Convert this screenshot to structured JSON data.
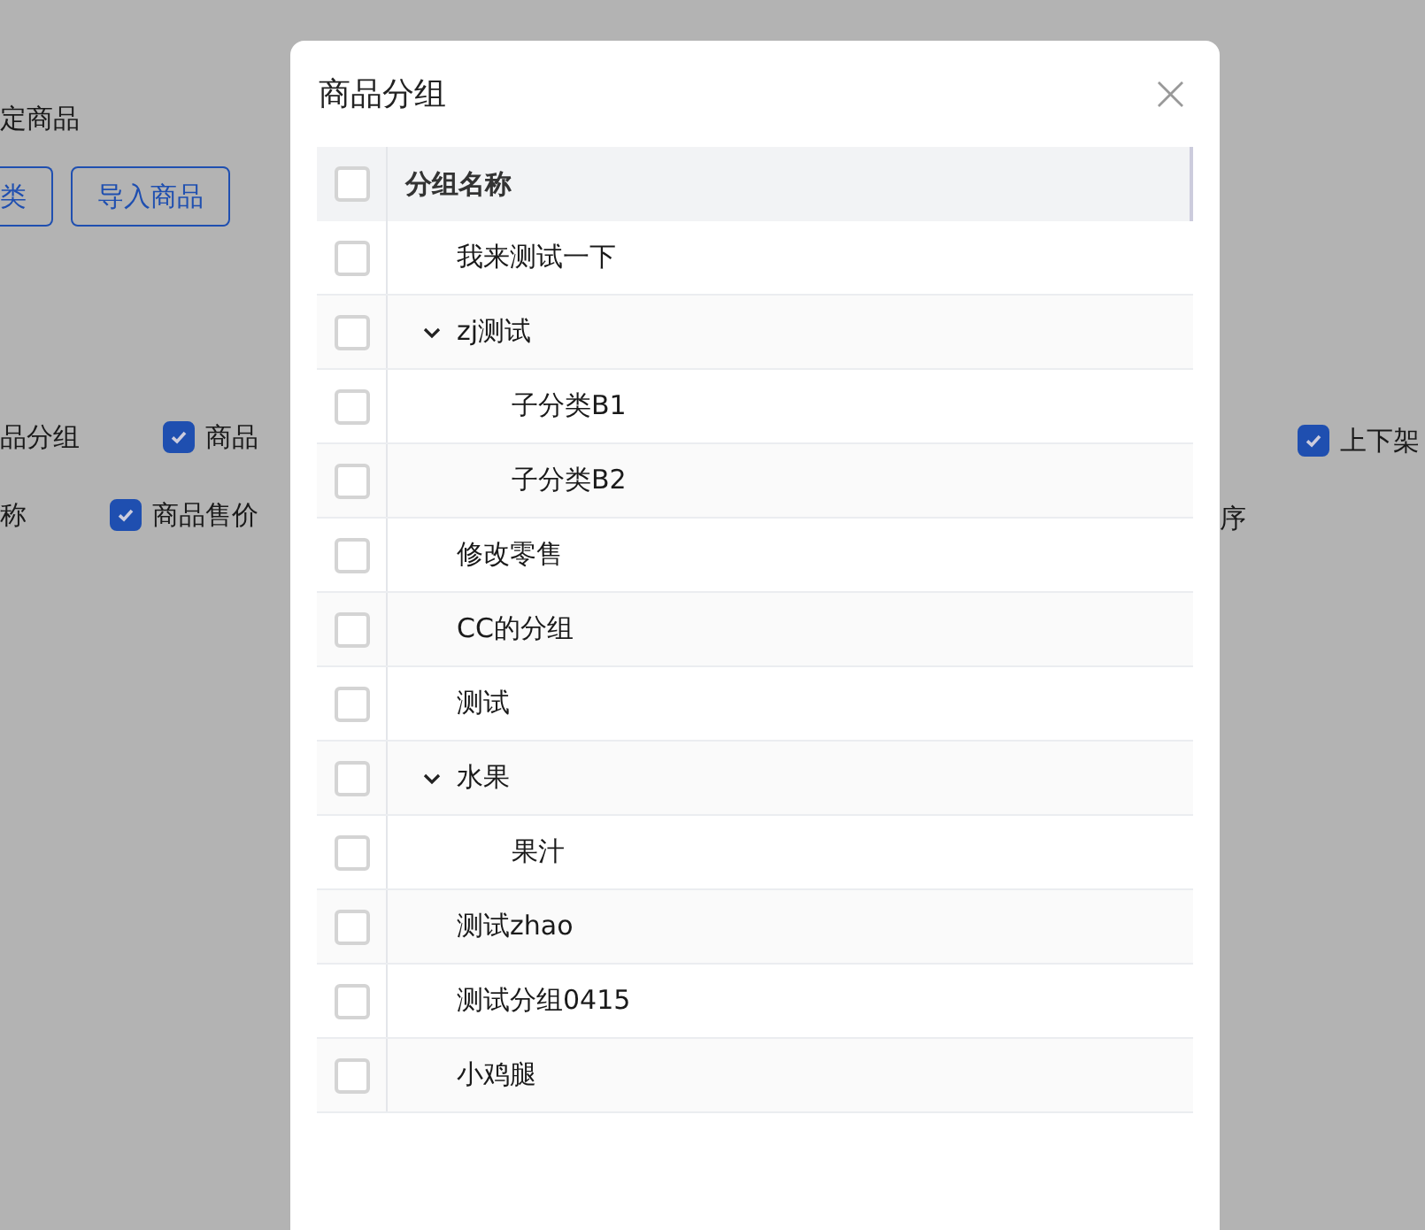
{
  "background_page": {
    "heading": "定商品",
    "buttons": [
      {
        "label": "类"
      },
      {
        "label": "导入商品"
      }
    ],
    "field_rows": [
      [
        {
          "kind": "text",
          "label": "品分组"
        },
        {
          "kind": "checkbox",
          "label": "商品",
          "checked": true
        }
      ],
      [
        {
          "kind": "text",
          "label": "称"
        },
        {
          "kind": "checkbox",
          "label": "商品售价",
          "checked": true
        }
      ]
    ],
    "right_rows": [
      {
        "kind": "checkbox",
        "label": "上下架",
        "checked": true
      },
      {
        "kind": "text",
        "label": "序"
      }
    ]
  },
  "dialog": {
    "title": "商品分组",
    "close": "×",
    "table": {
      "select_all": {
        "checked": false
      },
      "columns": [
        "分组名称"
      ],
      "groups": [
        {
          "name": "我来测试一下",
          "checked": false
        },
        {
          "name": "zj测试",
          "checked": false,
          "expanded": true,
          "children": [
            {
              "name": "子分类B1",
              "checked": false
            },
            {
              "name": "子分类B2",
              "checked": false
            }
          ]
        },
        {
          "name": "修改零售",
          "checked": false
        },
        {
          "name": "CC的分组",
          "checked": false
        },
        {
          "name": "测试",
          "checked": false
        },
        {
          "name": "水果",
          "checked": false,
          "expanded": true,
          "children": [
            {
              "name": "果汁",
              "checked": false
            }
          ]
        },
        {
          "name": "测试zhao",
          "checked": false
        },
        {
          "name": "测试分组0415",
          "checked": false
        },
        {
          "name": "小鸡腿",
          "checked": false
        }
      ]
    }
  }
}
